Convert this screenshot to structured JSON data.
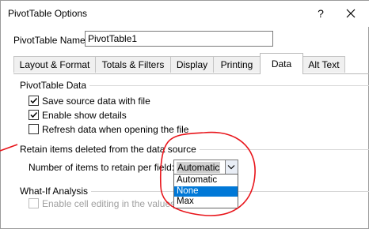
{
  "window": {
    "title": "PivotTable Options",
    "help_glyph": "?",
    "close_glyph": "✕"
  },
  "name_field": {
    "label": "PivotTable Name:",
    "value": "PivotTable1"
  },
  "tabs": [
    {
      "label": "Layout & Format"
    },
    {
      "label": "Totals & Filters"
    },
    {
      "label": "Display"
    },
    {
      "label": "Printing"
    },
    {
      "label": "Data",
      "active": true
    },
    {
      "label": "Alt Text"
    }
  ],
  "pivot_data": {
    "heading": "PivotTable Data",
    "options": [
      {
        "label": "Save source data with file",
        "checked": true
      },
      {
        "label": "Enable show details",
        "checked": true
      },
      {
        "label": "Refresh data when opening the file",
        "checked": false
      }
    ]
  },
  "retain": {
    "heading": "Retain items deleted from the data source",
    "field_label": "Number of items to retain per field:",
    "selected_value": "Automatic",
    "dropdown_options": [
      {
        "label": "Automatic",
        "highlighted": false
      },
      {
        "label": "None",
        "highlighted": true
      },
      {
        "label": "Max",
        "highlighted": false
      }
    ]
  },
  "what_if": {
    "heading": "What-If Analysis",
    "option": {
      "label": "Enable cell editing in the values",
      "checked": false,
      "disabled": true
    }
  },
  "colors": {
    "accent": "#0078d7",
    "annotation": "#e8141a",
    "border": "#7a7a7a",
    "disabled_text": "#a0a0a0"
  },
  "icons": {
    "help": "question-mark-icon",
    "close": "close-icon",
    "check": "check-mark-icon",
    "dropdown": "chevron-down-icon"
  }
}
